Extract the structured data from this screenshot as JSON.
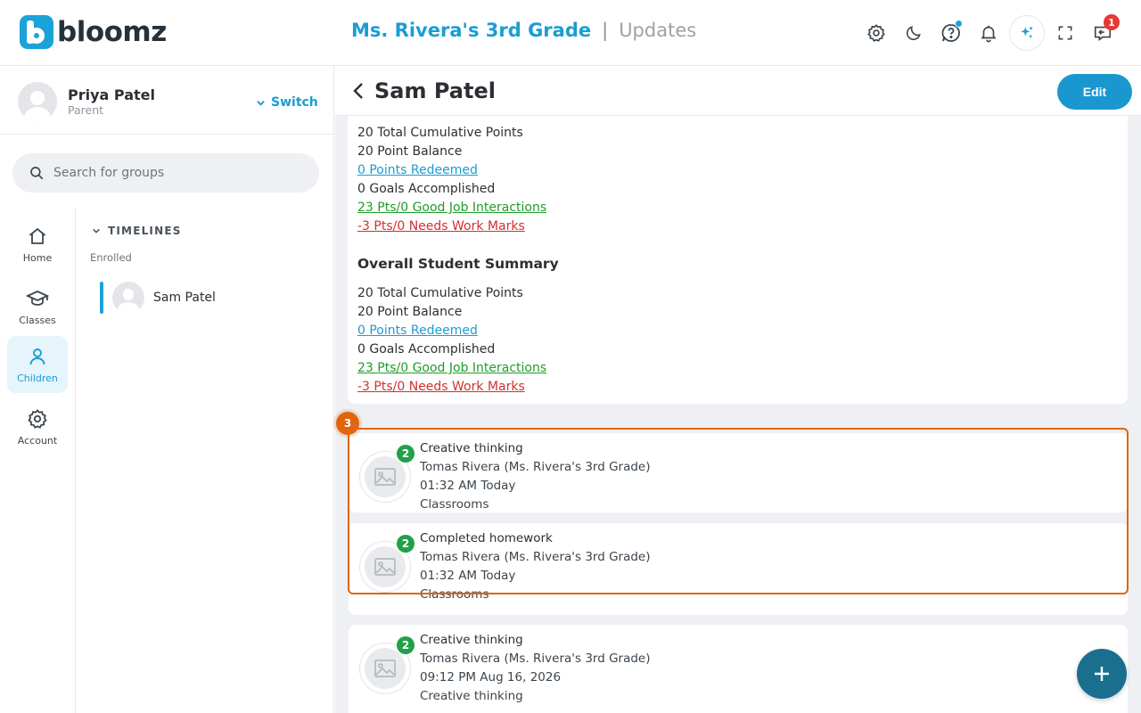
{
  "app": {
    "logo_text": "bloomz",
    "brand_color": "#1a9dd3"
  },
  "header": {
    "class_name": "Ms. Rivera's 3rd Grade",
    "separator": "|",
    "section": "Updates",
    "icons": [
      "settings-icon",
      "moon-icon",
      "help-icon",
      "bell-icon",
      "ai-sparkle-icon",
      "fullscreen-icon",
      "inbox-icon"
    ],
    "inbox_count": "1"
  },
  "profile": {
    "name": "Priya Patel",
    "role": "Parent",
    "switch_label": "Switch"
  },
  "search": {
    "placeholder": "Search for groups"
  },
  "nav": [
    {
      "label": "Home",
      "icon": "home-icon"
    },
    {
      "label": "Classes",
      "icon": "graduation-cap-icon"
    },
    {
      "label": "Children",
      "icon": "person-icon",
      "active": true
    },
    {
      "label": "Account",
      "icon": "gear-icon"
    }
  ],
  "timelines": {
    "heading": "TIMELINES",
    "group_label": "Enrolled",
    "children": [
      {
        "name": "Sam Patel"
      }
    ]
  },
  "detail": {
    "title": "Sam Patel",
    "edit_label": "Edit"
  },
  "class_summary": {
    "total_points": "20 Total Cumulative Points",
    "balance": "20 Point Balance",
    "redeemed": "0 Points Redeemed",
    "goals": "0 Goals Accomplished",
    "good_job": "23 Pts/0 Good Job Interactions",
    "needs_work": "-3 Pts/0 Needs Work Marks"
  },
  "overall_summary": {
    "title": "Overall Student Summary",
    "total_points": "20 Total Cumulative Points",
    "balance": "20 Point Balance",
    "redeemed": "0 Points Redeemed",
    "goals": "0 Goals Accomplished",
    "good_job": "23 Pts/0 Good Job Interactions",
    "needs_work": "-3 Pts/0 Needs Work Marks"
  },
  "posts": [
    {
      "title": "Creative thinking",
      "author": "Tomas Rivera (Ms. Rivera's 3rd Grade)",
      "time": "01:32 AM Today",
      "category": "Classrooms",
      "badge": "2"
    },
    {
      "title": "Completed homework",
      "author": "Tomas Rivera (Ms. Rivera's 3rd Grade)",
      "time": "01:32 AM Today",
      "category": "Classrooms",
      "badge": "2"
    },
    {
      "title": "Creative thinking",
      "author": "Tomas Rivera (Ms. Rivera's 3rd Grade)",
      "time": "09:12 PM Aug 16, 2026",
      "category": "Creative thinking",
      "badge": "2"
    }
  ],
  "step_marker": "3",
  "colors": {
    "accent": "#1a9dd3",
    "highlight": "#e0650f",
    "success": "#21a049",
    "danger": "#d32f2f",
    "link_green": "#1f9d2a"
  }
}
